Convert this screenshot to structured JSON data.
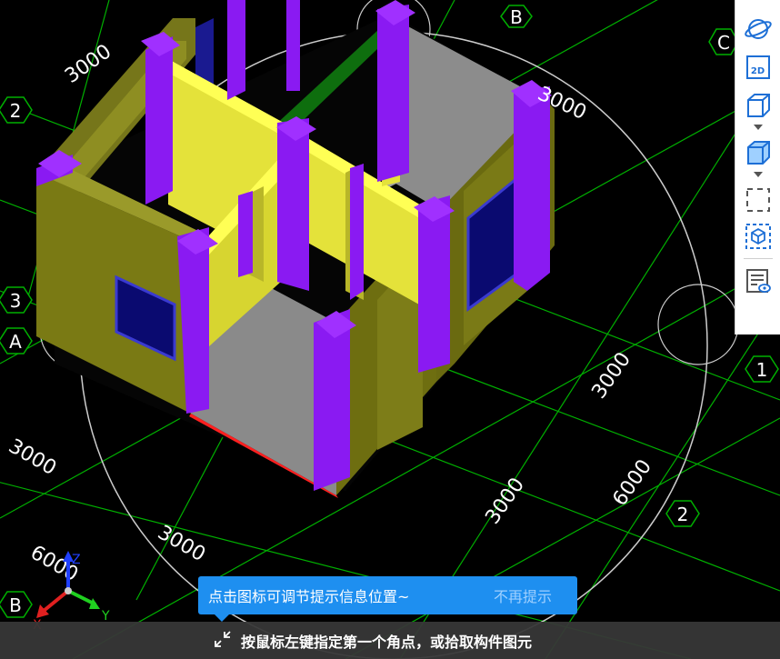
{
  "grid_axes": {
    "a": "A",
    "b": "B",
    "c": "C",
    "n1": "1",
    "n2": "2",
    "n3": "3"
  },
  "dimensions": {
    "d1": "3000",
    "d2": "3000",
    "d3": "3000",
    "d4": "3000",
    "d5": "3000",
    "d6": "3000",
    "d7": "6000",
    "d8": "6000"
  },
  "coordinate_triad": {
    "x": "X",
    "y": "Y",
    "z": "Z"
  },
  "toolbar": {
    "orbit_icon": "orbit-icon",
    "view2d_label": "2D",
    "box_icon": "box-icon",
    "box_filled_icon": "box-filled-icon",
    "select_region_icon": "dashed-rect-icon",
    "select_component_icon": "dashed-cube-icon",
    "property_icon": "list-eye-icon"
  },
  "hint": {
    "message": "点击图标可调节提示信息位置~",
    "dismiss": "不再提示"
  },
  "status": {
    "prompt": "按鼠标左键指定第一个角点，或拾取构件图元"
  },
  "colors": {
    "grid": "#00b000",
    "wall_olive": "#7a7a10",
    "wall_yellow": "#e2e040",
    "column": "#8a19f0",
    "concrete": "#8c8c8c",
    "tooltip": "#1e8ff0"
  }
}
